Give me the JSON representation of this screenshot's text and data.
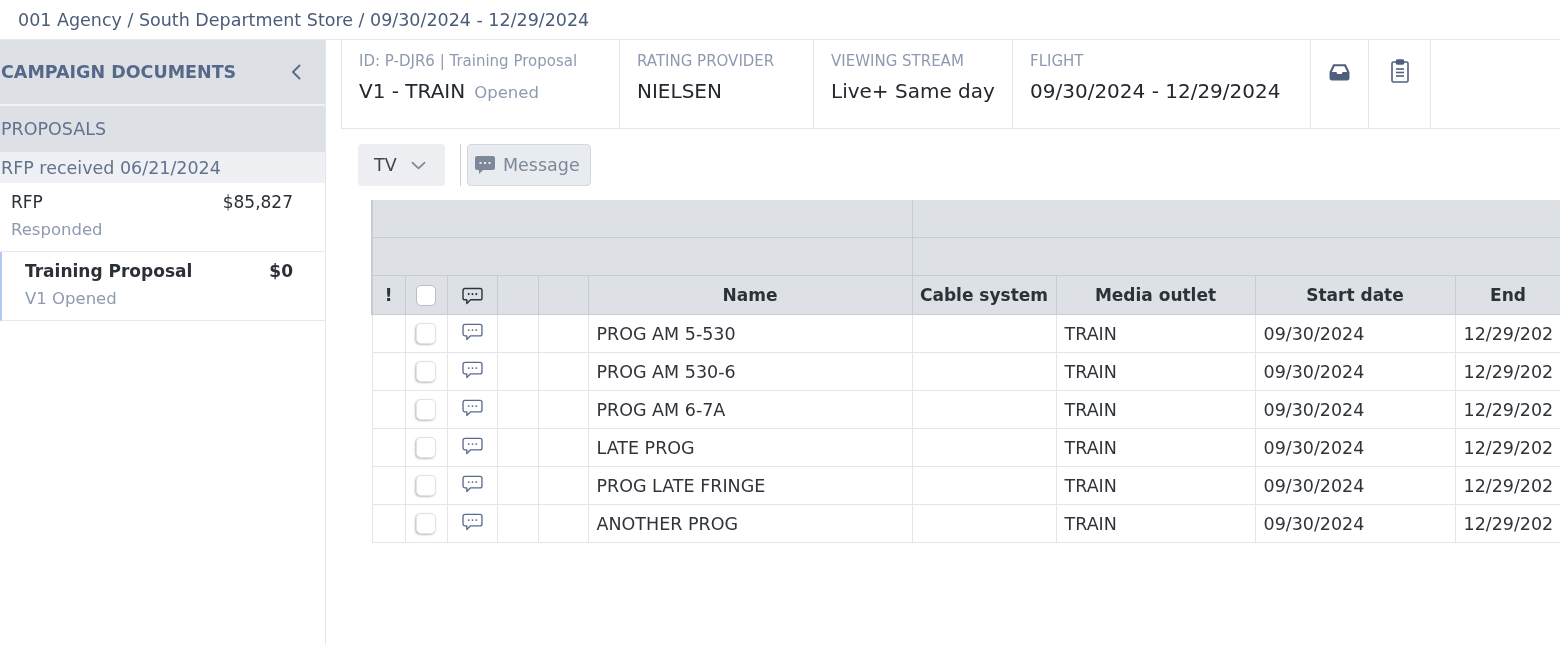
{
  "breadcrumb": "001 Agency / South Department Store / 09/30/2024 - 12/29/2024",
  "sidebar": {
    "title": "CAMPAIGN DOCUMENTS",
    "section": "PROPOSALS",
    "group": "RFP received 06/21/2024",
    "items": [
      {
        "name": "RFP",
        "amount": "$85,827",
        "status": "Responded",
        "selected": false,
        "children": [
          {
            "name": "Training Proposal",
            "amount": "$0",
            "status": "V1 Opened",
            "selected": true
          }
        ]
      }
    ]
  },
  "header": {
    "id_line": "ID: P-DJR6 | Training Proposal",
    "version": "V1 - TRAIN",
    "status": "Opened",
    "fields": [
      {
        "label": "RATING PROVIDER",
        "value": "NIELSEN"
      },
      {
        "label": "VIEWING STREAM",
        "value": "Live+ Same day"
      },
      {
        "label": "FLIGHT",
        "value": "09/30/2024 - 12/29/2024"
      }
    ]
  },
  "toolbar": {
    "media_type": "TV",
    "message_button": {
      "label": "Message",
      "disabled": true
    }
  },
  "table": {
    "columns": [
      {
        "kind": "flag",
        "label": "!"
      },
      {
        "kind": "checkbox",
        "checked": false
      },
      {
        "kind": "comment"
      },
      {
        "kind": "blank"
      },
      {
        "kind": "blank"
      },
      {
        "kind": "text",
        "label": "Name"
      },
      {
        "kind": "text",
        "label": "Cable system"
      },
      {
        "kind": "text",
        "label": "Media outlet"
      },
      {
        "kind": "text",
        "label": "Start date"
      },
      {
        "kind": "text",
        "label": "End"
      }
    ],
    "rows": [
      {
        "checked": false,
        "name": "PROG AM 5-530",
        "media_outlet": "TRAIN",
        "start_date": "09/30/2024",
        "column_10": "12/29/202"
      },
      {
        "checked": false,
        "name": "PROG AM 530-6",
        "media_outlet": "TRAIN",
        "start_date": "09/30/2024",
        "column_10": "12/29/202"
      },
      {
        "checked": false,
        "name": "PROG AM 6-7A",
        "media_outlet": "TRAIN",
        "start_date": "09/30/2024",
        "column_10": "12/29/202"
      },
      {
        "checked": false,
        "name": "LATE PROG",
        "media_outlet": "TRAIN",
        "start_date": "09/30/2024",
        "column_10": "12/29/202"
      },
      {
        "checked": false,
        "name": "PROG LATE FRINGE",
        "media_outlet": "TRAIN",
        "start_date": "09/30/2024",
        "column_10": "12/29/202"
      },
      {
        "checked": false,
        "name": "ANOTHER PROG",
        "media_outlet": "TRAIN",
        "start_date": "09/30/2024",
        "column_10": "12/29/202"
      }
    ]
  }
}
